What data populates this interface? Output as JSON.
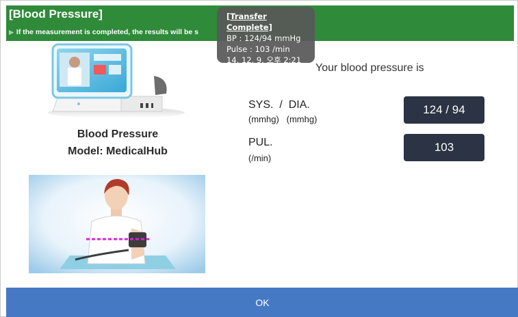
{
  "header": {
    "title": "[Blood Pressure]",
    "subtitle": "If the measurement is completed, the results will be s"
  },
  "toast": {
    "title": "[Transfer Complete]",
    "bp": "BP : 124/94 mmHg",
    "pulse": "Pulse : 103 /min",
    "time": "14. 12. 9. 오후 2:21"
  },
  "device": {
    "name": "Blood Pressure",
    "model": "Model: MedicalHub"
  },
  "result": {
    "heading": "Your blood pressure is",
    "sys_dia_label": "SYS.  /  DIA.",
    "sys_dia_unit": "(mmhg)   (mmhg)",
    "sys_dia_value": "124 / 94",
    "pul_label": "PUL.",
    "pul_unit": "(/min)",
    "pul_value": "103"
  },
  "footer": {
    "ok_label": "OK"
  },
  "colors": {
    "header_green": "#2f8a3a",
    "ok_blue": "#4579c4",
    "value_box": "#2b3344"
  }
}
